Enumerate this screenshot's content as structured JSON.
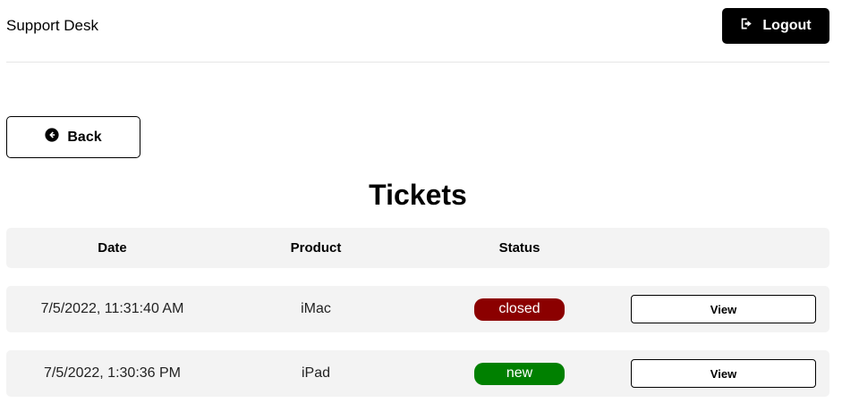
{
  "header": {
    "brand": "Support Desk",
    "logout_label": "Logout",
    "logout_icon": "sign-out-icon"
  },
  "back": {
    "label": "Back",
    "icon": "arrow-circle-left-icon"
  },
  "page_title": "Tickets",
  "table": {
    "columns": [
      "Date",
      "Product",
      "Status",
      ""
    ],
    "rows": [
      {
        "date": "7/5/2022, 11:31:40 AM",
        "product": "iMac",
        "status": "closed",
        "status_color": "#8b0000",
        "action": "View"
      },
      {
        "date": "7/5/2022, 1:30:36 PM",
        "product": "iPad",
        "status": "new",
        "status_color": "#008000",
        "action": "View"
      }
    ]
  },
  "colors": {
    "header_button_bg": "#000000",
    "row_bg": "#f3f3f3"
  }
}
